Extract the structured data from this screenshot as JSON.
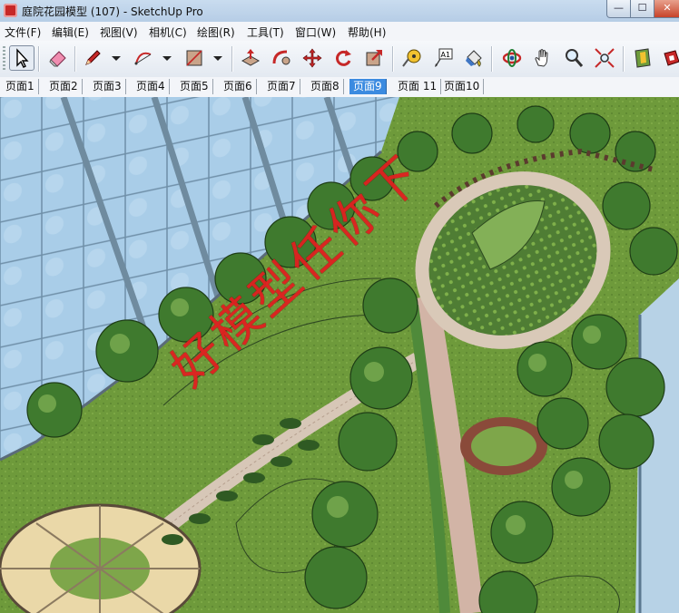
{
  "window": {
    "title": "庭院花园模型 (107) - SketchUp Pro",
    "min_label": "—",
    "max_label": "☐",
    "close_label": "✕"
  },
  "menu": [
    {
      "label": "文件(F)"
    },
    {
      "label": "编辑(E)"
    },
    {
      "label": "视图(V)"
    },
    {
      "label": "相机(C)"
    },
    {
      "label": "绘图(R)"
    },
    {
      "label": "工具(T)"
    },
    {
      "label": "窗口(W)"
    },
    {
      "label": "帮助(H)"
    }
  ],
  "toolbar": {
    "tools": [
      {
        "name": "select-tool",
        "icon": "arrow-icon"
      },
      {
        "name": "eraser-tool",
        "icon": "eraser-icon"
      },
      {
        "name": "pencil-tool",
        "icon": "pencil-icon"
      },
      {
        "name": "arc-tool",
        "icon": "arc-icon"
      },
      {
        "name": "rectangle-tool",
        "icon": "rectangle-icon"
      },
      {
        "name": "push-pull-tool",
        "icon": "push-pull-icon"
      },
      {
        "name": "follow-me-tool",
        "icon": "follow-me-icon"
      },
      {
        "name": "move-tool",
        "icon": "move-icon"
      },
      {
        "name": "rotate-tool",
        "icon": "rotate-icon"
      },
      {
        "name": "scale-tool",
        "icon": "scale-icon"
      },
      {
        "name": "tape-measure-tool",
        "icon": "tape-measure-icon"
      },
      {
        "name": "text-tool",
        "icon": "text-icon",
        "text": "A1"
      },
      {
        "name": "paint-bucket-tool",
        "icon": "paint-bucket-icon"
      },
      {
        "name": "orbit-tool",
        "icon": "orbit-icon"
      },
      {
        "name": "pan-tool",
        "icon": "hand-icon"
      },
      {
        "name": "zoom-tool",
        "icon": "magnifier-icon"
      },
      {
        "name": "zoom-extents-tool",
        "icon": "zoom-extents-icon"
      },
      {
        "name": "warehouse-tool",
        "icon": "warehouse-icon"
      },
      {
        "name": "extension-tool",
        "icon": "extension-icon"
      }
    ]
  },
  "scenes": {
    "active_index": 8,
    "tabs": [
      {
        "label": "页面1"
      },
      {
        "label": "页面2"
      },
      {
        "label": "页面3"
      },
      {
        "label": "页面4"
      },
      {
        "label": "页面5"
      },
      {
        "label": "页面6"
      },
      {
        "label": "页面7"
      },
      {
        "label": "页面8"
      },
      {
        "label": "页面9"
      },
      {
        "label": "页面 11"
      },
      {
        "label": "页面10"
      }
    ]
  },
  "viewport": {
    "watermark": "好模型任你下"
  }
}
